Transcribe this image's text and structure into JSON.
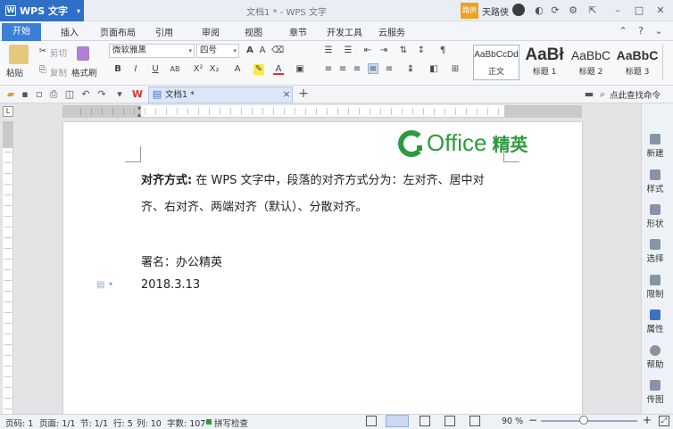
{
  "titlebar": {
    "app_name": "WPS 文字",
    "doc_title": "文档1 * - WPS 文字",
    "badge": "路供",
    "user": "天路侠"
  },
  "menu_tabs": [
    "开始",
    "插入",
    "页面布局",
    "引用",
    "审阅",
    "视图",
    "章节",
    "开发工具",
    "云服务"
  ],
  "ribbon": {
    "paste": "粘贴",
    "cut": "剪切",
    "copy": "复制",
    "format_painter": "格式刷",
    "font_name": "微软雅黑",
    "font_size": "四号",
    "styles": [
      {
        "sample": "AaBbCcDd",
        "name": "正文"
      },
      {
        "sample": "AaBł",
        "name": "标题 1"
      },
      {
        "sample": "AaBbC",
        "name": "标题 2"
      },
      {
        "sample": "AaBbC",
        "name": "标题 3"
      }
    ]
  },
  "toolbar2": {
    "doc_tab": "文档1 *",
    "search_cmd": "点此查找命令"
  },
  "document": {
    "logo_text": "Office",
    "logo_cn": "精英",
    "line1_bold": "对齐方式:",
    "line1_rest": " 在 WPS  文字中，段落的对齐方式分为：左对齐、居中对",
    "line2": "齐、右对齐、两端对齐（默认）、分散对齐。",
    "signature": "署名：办公精英",
    "date": "2018.3.13"
  },
  "right_panel": [
    "新建",
    "样式",
    "形状",
    "选择",
    "限制",
    "属性",
    "帮助",
    "传图"
  ],
  "statusbar": {
    "page_num": "页码: 1",
    "page_count": "页面: 1/1",
    "section": "节: 1/1",
    "row": "行: 5",
    "col": "列: 10",
    "word_count": "字数: 107",
    "spell": "拼写检查",
    "zoom": "90 %"
  }
}
